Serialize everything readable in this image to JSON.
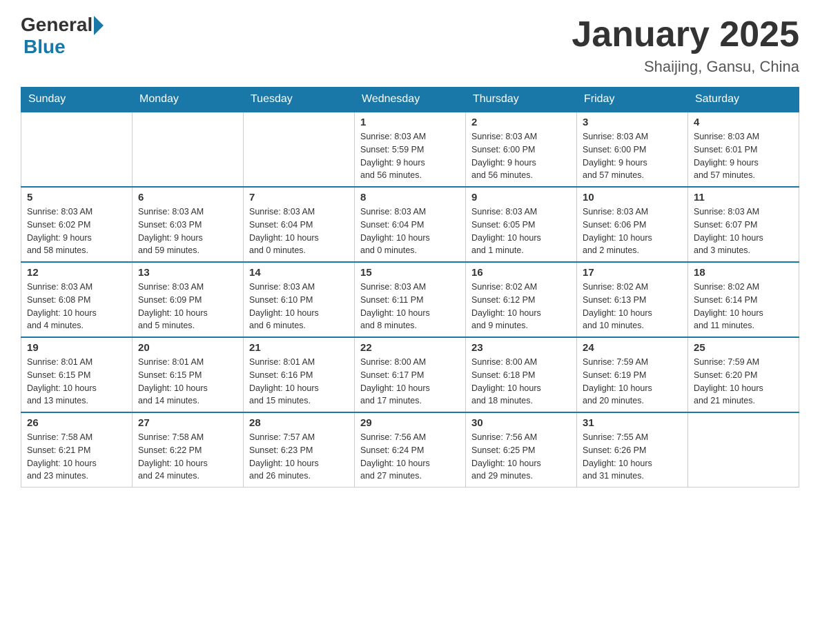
{
  "header": {
    "logo_general": "General",
    "logo_blue": "Blue",
    "title": "January 2025",
    "subtitle": "Shaijing, Gansu, China"
  },
  "days_of_week": [
    "Sunday",
    "Monday",
    "Tuesday",
    "Wednesday",
    "Thursday",
    "Friday",
    "Saturday"
  ],
  "weeks": [
    [
      {
        "day": "",
        "info": ""
      },
      {
        "day": "",
        "info": ""
      },
      {
        "day": "",
        "info": ""
      },
      {
        "day": "1",
        "info": "Sunrise: 8:03 AM\nSunset: 5:59 PM\nDaylight: 9 hours\nand 56 minutes."
      },
      {
        "day": "2",
        "info": "Sunrise: 8:03 AM\nSunset: 6:00 PM\nDaylight: 9 hours\nand 56 minutes."
      },
      {
        "day": "3",
        "info": "Sunrise: 8:03 AM\nSunset: 6:00 PM\nDaylight: 9 hours\nand 57 minutes."
      },
      {
        "day": "4",
        "info": "Sunrise: 8:03 AM\nSunset: 6:01 PM\nDaylight: 9 hours\nand 57 minutes."
      }
    ],
    [
      {
        "day": "5",
        "info": "Sunrise: 8:03 AM\nSunset: 6:02 PM\nDaylight: 9 hours\nand 58 minutes."
      },
      {
        "day": "6",
        "info": "Sunrise: 8:03 AM\nSunset: 6:03 PM\nDaylight: 9 hours\nand 59 minutes."
      },
      {
        "day": "7",
        "info": "Sunrise: 8:03 AM\nSunset: 6:04 PM\nDaylight: 10 hours\nand 0 minutes."
      },
      {
        "day": "8",
        "info": "Sunrise: 8:03 AM\nSunset: 6:04 PM\nDaylight: 10 hours\nand 0 minutes."
      },
      {
        "day": "9",
        "info": "Sunrise: 8:03 AM\nSunset: 6:05 PM\nDaylight: 10 hours\nand 1 minute."
      },
      {
        "day": "10",
        "info": "Sunrise: 8:03 AM\nSunset: 6:06 PM\nDaylight: 10 hours\nand 2 minutes."
      },
      {
        "day": "11",
        "info": "Sunrise: 8:03 AM\nSunset: 6:07 PM\nDaylight: 10 hours\nand 3 minutes."
      }
    ],
    [
      {
        "day": "12",
        "info": "Sunrise: 8:03 AM\nSunset: 6:08 PM\nDaylight: 10 hours\nand 4 minutes."
      },
      {
        "day": "13",
        "info": "Sunrise: 8:03 AM\nSunset: 6:09 PM\nDaylight: 10 hours\nand 5 minutes."
      },
      {
        "day": "14",
        "info": "Sunrise: 8:03 AM\nSunset: 6:10 PM\nDaylight: 10 hours\nand 6 minutes."
      },
      {
        "day": "15",
        "info": "Sunrise: 8:03 AM\nSunset: 6:11 PM\nDaylight: 10 hours\nand 8 minutes."
      },
      {
        "day": "16",
        "info": "Sunrise: 8:02 AM\nSunset: 6:12 PM\nDaylight: 10 hours\nand 9 minutes."
      },
      {
        "day": "17",
        "info": "Sunrise: 8:02 AM\nSunset: 6:13 PM\nDaylight: 10 hours\nand 10 minutes."
      },
      {
        "day": "18",
        "info": "Sunrise: 8:02 AM\nSunset: 6:14 PM\nDaylight: 10 hours\nand 11 minutes."
      }
    ],
    [
      {
        "day": "19",
        "info": "Sunrise: 8:01 AM\nSunset: 6:15 PM\nDaylight: 10 hours\nand 13 minutes."
      },
      {
        "day": "20",
        "info": "Sunrise: 8:01 AM\nSunset: 6:15 PM\nDaylight: 10 hours\nand 14 minutes."
      },
      {
        "day": "21",
        "info": "Sunrise: 8:01 AM\nSunset: 6:16 PM\nDaylight: 10 hours\nand 15 minutes."
      },
      {
        "day": "22",
        "info": "Sunrise: 8:00 AM\nSunset: 6:17 PM\nDaylight: 10 hours\nand 17 minutes."
      },
      {
        "day": "23",
        "info": "Sunrise: 8:00 AM\nSunset: 6:18 PM\nDaylight: 10 hours\nand 18 minutes."
      },
      {
        "day": "24",
        "info": "Sunrise: 7:59 AM\nSunset: 6:19 PM\nDaylight: 10 hours\nand 20 minutes."
      },
      {
        "day": "25",
        "info": "Sunrise: 7:59 AM\nSunset: 6:20 PM\nDaylight: 10 hours\nand 21 minutes."
      }
    ],
    [
      {
        "day": "26",
        "info": "Sunrise: 7:58 AM\nSunset: 6:21 PM\nDaylight: 10 hours\nand 23 minutes."
      },
      {
        "day": "27",
        "info": "Sunrise: 7:58 AM\nSunset: 6:22 PM\nDaylight: 10 hours\nand 24 minutes."
      },
      {
        "day": "28",
        "info": "Sunrise: 7:57 AM\nSunset: 6:23 PM\nDaylight: 10 hours\nand 26 minutes."
      },
      {
        "day": "29",
        "info": "Sunrise: 7:56 AM\nSunset: 6:24 PM\nDaylight: 10 hours\nand 27 minutes."
      },
      {
        "day": "30",
        "info": "Sunrise: 7:56 AM\nSunset: 6:25 PM\nDaylight: 10 hours\nand 29 minutes."
      },
      {
        "day": "31",
        "info": "Sunrise: 7:55 AM\nSunset: 6:26 PM\nDaylight: 10 hours\nand 31 minutes."
      },
      {
        "day": "",
        "info": ""
      }
    ]
  ]
}
